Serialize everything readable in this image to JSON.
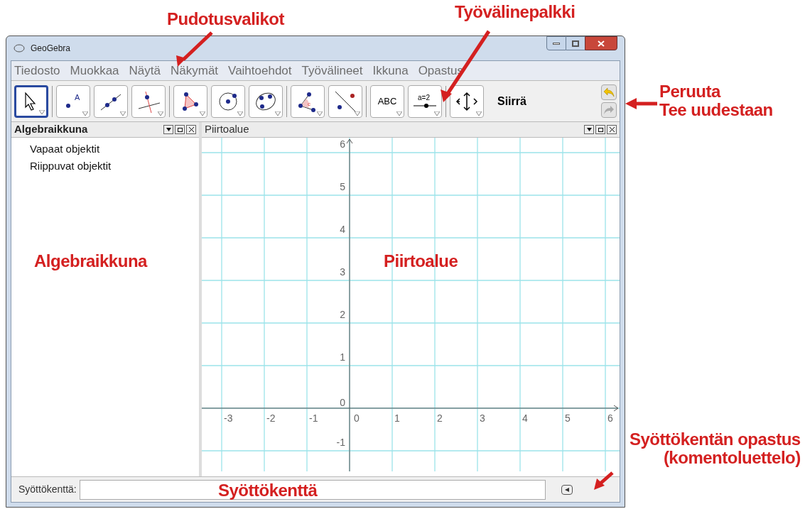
{
  "window": {
    "title": "GeoGebra"
  },
  "menu": [
    "Tiedosto",
    "Muokkaa",
    "Näytä",
    "Näkymät",
    "Vaihtoehdot",
    "Työvälineet",
    "Ikkuna",
    "Opastus"
  ],
  "toolbar": {
    "tools": [
      {
        "kind": "move",
        "selected": true
      },
      {
        "kind": "point",
        "label": "A",
        "selected": false
      },
      {
        "kind": "line",
        "selected": false
      },
      {
        "kind": "perpendicular",
        "selected": false
      },
      {
        "kind": "polygon",
        "selected": false
      },
      {
        "kind": "circle",
        "selected": false
      },
      {
        "kind": "conic",
        "selected": false
      },
      {
        "kind": "angle",
        "label": "c",
        "selected": false
      },
      {
        "kind": "reflect",
        "selected": false
      },
      {
        "kind": "text",
        "label": "ABC",
        "selected": false
      },
      {
        "kind": "slider",
        "label": "a=2",
        "selected": false
      },
      {
        "kind": "translate",
        "selected": false
      }
    ],
    "tool_name": "Siirrä"
  },
  "algebra_view": {
    "title": "Algebraikkuna",
    "items": [
      "Vapaat objektit",
      "Riippuvat objektit"
    ]
  },
  "graphics_view": {
    "title": "Piirtoalue",
    "x_labels": [
      "-3",
      "-2",
      "-1",
      "0",
      "1",
      "2",
      "3",
      "4",
      "5",
      "6"
    ],
    "y_labels": [
      "6",
      "5",
      "4",
      "3",
      "2",
      "1",
      "0",
      "-1"
    ]
  },
  "input_bar": {
    "label": "Syöttökenttä:"
  },
  "annotations": [
    {
      "kind": "menus",
      "lines": [
        "Pudotusvalikot"
      ]
    },
    {
      "kind": "toolbar",
      "lines": [
        "Työvälinepalkki"
      ]
    },
    {
      "kind": "undo",
      "lines": [
        "Peruuta",
        "Tee uudestaan"
      ]
    },
    {
      "kind": "algebra",
      "lines": [
        "Algebraikkuna"
      ]
    },
    {
      "kind": "graphics",
      "lines": [
        "Piirtoalue"
      ]
    },
    {
      "kind": "help",
      "lines": [
        "Syöttökentän opastus",
        "(komentoluettelo)"
      ]
    },
    {
      "kind": "input",
      "lines": [
        "Syöttökenttä"
      ]
    }
  ]
}
